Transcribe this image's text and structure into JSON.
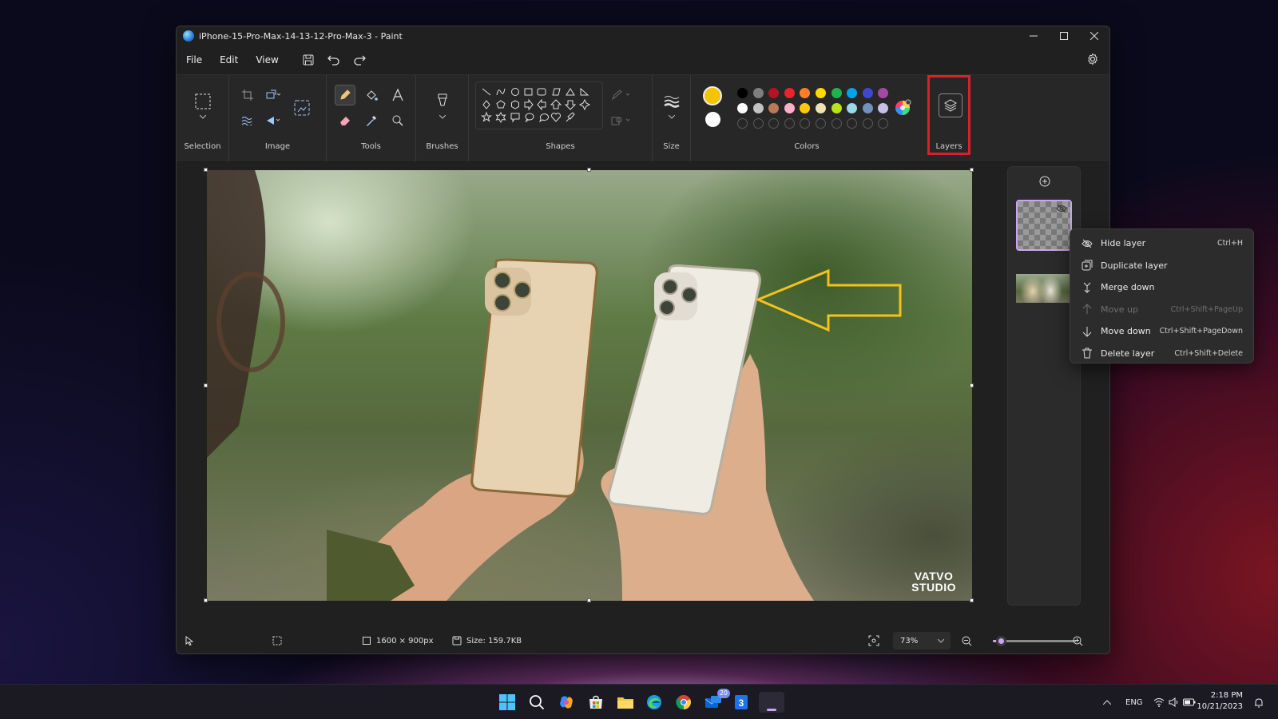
{
  "window": {
    "title": "iPhone-15-Pro-Max-14-13-12-Pro-Max-3 - Paint",
    "controls": [
      "minimize-icon",
      "maximize-icon",
      "close-icon"
    ]
  },
  "menu": {
    "file": "File",
    "edit": "Edit",
    "view": "View",
    "icons": [
      "save-icon",
      "undo-icon",
      "redo-icon",
      "settings-icon"
    ]
  },
  "ribbon": {
    "groups": {
      "selection": "Selection",
      "image": "Image",
      "tools": "Tools",
      "brushes": "Brushes",
      "shapes": "Shapes",
      "size": "Size",
      "colors": "Colors",
      "layers": "Layers"
    },
    "primary_color": "#f5c400",
    "secondary_color": "#ffffff",
    "palette_row1": [
      "#000000",
      "#7f7f7f",
      "#b3141f",
      "#e8242f",
      "#ff7f27",
      "#ffd800",
      "#22b14c",
      "#00a2e8",
      "#3f48cc",
      "#a349a4"
    ],
    "palette_row2": [
      "#ffffff",
      "#c3c3c3",
      "#b97a57",
      "#ffaec9",
      "#ffc90e",
      "#efe4b0",
      "#b5e61d",
      "#99d9ea",
      "#7092be",
      "#c8bfe7"
    ],
    "layers_highlight_color": "#d9202e"
  },
  "canvas": {
    "watermark_line1": "VATVO",
    "watermark_line2": "STUDIO",
    "arrow_color": "#f2c31b"
  },
  "layers_panel": {
    "add_icon": "add-layer-icon",
    "layers": [
      {
        "name": "layer-1",
        "kind": "transparent",
        "selected": true,
        "hidden_icon": "eye-off-icon"
      },
      {
        "name": "layer-2",
        "kind": "photo",
        "selected": false
      }
    ]
  },
  "context_menu": {
    "items": [
      {
        "label": "Hide layer",
        "shortcut": "Ctrl+H",
        "icon": "eye-off-icon",
        "enabled": true
      },
      {
        "label": "Duplicate layer",
        "shortcut": "",
        "icon": "duplicate-icon",
        "enabled": true
      },
      {
        "label": "Merge down",
        "shortcut": "",
        "icon": "merge-down-icon",
        "enabled": true
      },
      {
        "label": "Move up",
        "shortcut": "Ctrl+Shift+PageUp",
        "icon": "arrow-up-icon",
        "enabled": false
      },
      {
        "label": "Move down",
        "shortcut": "Ctrl+Shift+PageDown",
        "icon": "arrow-down-icon",
        "enabled": true
      },
      {
        "label": "Delete layer",
        "shortcut": "Ctrl+Shift+Delete",
        "icon": "trash-icon",
        "enabled": true
      }
    ]
  },
  "status": {
    "dimensions": "1600 × 900px",
    "size": "Size: 159.7KB",
    "zoom": "73%",
    "zoom_fraction": 0.1
  },
  "taskbar": {
    "apps": [
      "windows-start-icon",
      "search-icon",
      "copilot-icon",
      "store-icon",
      "file-explorer-icon",
      "edge-icon",
      "chrome-icon",
      "mail-icon",
      "calendar-icon",
      "paint-icon"
    ],
    "mail_badge": "20",
    "language": "ENG",
    "time": "2:18 PM",
    "date": "10/21/2023"
  }
}
